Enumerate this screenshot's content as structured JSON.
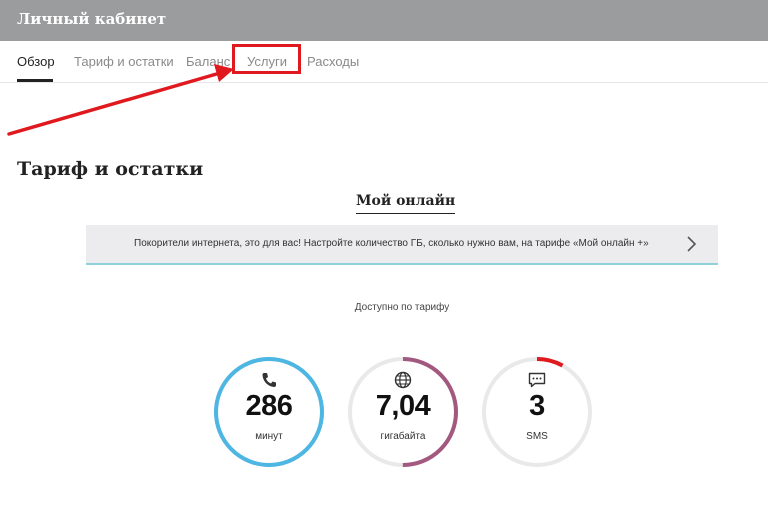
{
  "header": {
    "title": "Личный кабинет"
  },
  "tabs": [
    {
      "label": "Обзор",
      "active": true
    },
    {
      "label": "Тариф и остатки",
      "active": false
    },
    {
      "label": "Баланс",
      "active": false
    },
    {
      "label": "Услуги",
      "active": false,
      "highlighted": true
    },
    {
      "label": "Расходы",
      "active": false
    }
  ],
  "section": {
    "title": "Тариф и остатки"
  },
  "tariff": {
    "name": "Мой онлайн"
  },
  "promo": {
    "text": "Покорители интернета, это для вас! Настройте количество ГБ, сколько нужно вам, на тарифе «Мой онлайн +»",
    "icon": "chevron-right-icon"
  },
  "remaining": {
    "label": "Доступно по тарифу",
    "gauges": [
      {
        "name": "minutes",
        "value": "286",
        "unit": "минут",
        "icon": "phone-icon",
        "color": "#4db6e2",
        "fill": 1.0
      },
      {
        "name": "internet",
        "value": "7,04",
        "unit": "гигабайта",
        "icon": "globe-icon",
        "color": "#a2587f",
        "fill": 0.5
      },
      {
        "name": "sms",
        "value": "3",
        "unit": "SMS",
        "icon": "message-icon",
        "color": "#e0191f",
        "fill": 0.08
      }
    ]
  },
  "colors": {
    "topbar": "#9b9c9e",
    "annotation": "#e0191f",
    "track": "#e9e9e9"
  }
}
